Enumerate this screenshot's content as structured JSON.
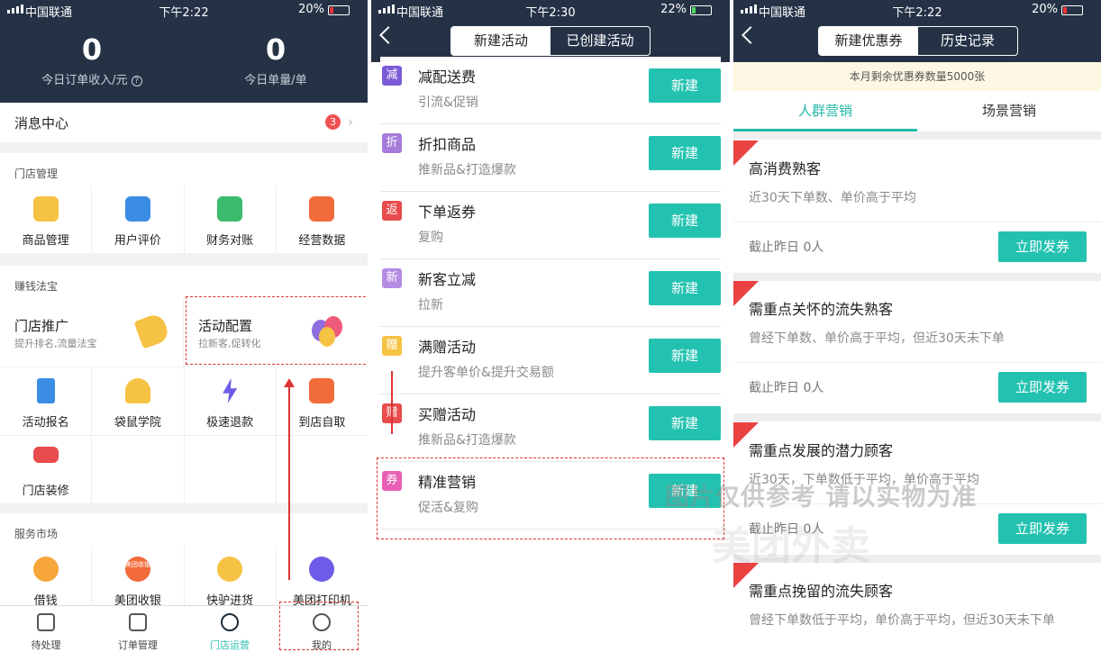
{
  "status": {
    "carrier": "中国联通",
    "time1": "下午2:22",
    "battery1": "20%",
    "time2": "下午2:30",
    "battery2": "22%",
    "time3": "下午2:22",
    "battery3": "20%"
  },
  "p1": {
    "stats": [
      {
        "value": "0",
        "label": "今日订单收入/元"
      },
      {
        "value": "0",
        "label": "今日单量/单"
      }
    ],
    "message": {
      "label": "消息中心",
      "count": "3"
    },
    "store_section": "门店管理",
    "store_items": [
      {
        "label": "商品管理",
        "color": "#f6c243"
      },
      {
        "label": "用户评价",
        "color": "#3b8de4"
      },
      {
        "label": "财务对账",
        "color": "#3dbb6c"
      },
      {
        "label": "经营数据",
        "color": "#f26b3a"
      }
    ],
    "money_section": "赚钱法宝",
    "promo": [
      {
        "title": "门店推广",
        "sub": "提升排名,流量法宝"
      },
      {
        "title": "活动配置",
        "sub": "拉新客,促转化"
      }
    ],
    "money_items": [
      {
        "label": "活动报名",
        "color": "#3b8de4"
      },
      {
        "label": "袋鼠学院",
        "color": "#f6c243"
      },
      {
        "label": "极速退款",
        "color": "#6c5ce7"
      },
      {
        "label": "到店自取",
        "color": "#f26b3a"
      },
      {
        "label": "门店装修",
        "color": "#e84c4c"
      }
    ],
    "service_section": "服务市场",
    "service_items": [
      {
        "label": "借钱",
        "color": "#f6a63a"
      },
      {
        "label": "美团收银",
        "color": "#f26b3a",
        "inner": "美团收银"
      },
      {
        "label": "快驴进货",
        "color": "#f6c243"
      },
      {
        "label": "美团打印机",
        "color": "#6c5ce7"
      }
    ],
    "tabs": [
      {
        "label": "待处理",
        "icon": "clipboard-icon"
      },
      {
        "label": "订单管理",
        "icon": "order-icon"
      },
      {
        "label": "门店运营",
        "icon": "network-icon"
      },
      {
        "label": "我的",
        "icon": "user-icon"
      }
    ]
  },
  "p2": {
    "tabs": [
      "新建活动",
      "已创建活动"
    ],
    "activities": [
      {
        "tag": "减",
        "tag_color": "#7b5bd6",
        "title": "减配送费",
        "sub": "引流&促销",
        "btn": "新建"
      },
      {
        "tag": "折",
        "tag_color": "#a67bd9",
        "title": "折扣商品",
        "sub": "推新品&打造爆款",
        "btn": "新建"
      },
      {
        "tag": "返",
        "tag_color": "#e84c4c",
        "title": "下单返券",
        "sub": "复购",
        "btn": "新建"
      },
      {
        "tag": "新",
        "tag_color": "#b58be3",
        "title": "新客立减",
        "sub": "拉新",
        "btn": "新建"
      },
      {
        "tag": "赠",
        "tag_color": "#f6c243",
        "title": "满赠活动",
        "sub": "提升客单价&提升交易额",
        "btn": "新建"
      },
      {
        "tag": "赠",
        "tag_color": "#e84c4c",
        "title": "买赠活动",
        "sub": "推新品&打造爆款",
        "btn": "新建"
      },
      {
        "tag": "券",
        "tag_color": "#e85fb3",
        "title": "精准营销",
        "sub": "促活&复购",
        "btn": "新建"
      }
    ]
  },
  "p3": {
    "tabs": [
      "新建优惠券",
      "历史记录"
    ],
    "notice": "本月剩余优惠券数量5000张",
    "subtabs": [
      "人群营销",
      "场景营销"
    ],
    "coupons": [
      {
        "title": "高消费熟客",
        "desc": "近30天下单数、单价高于平均",
        "count": "截止昨日 0人",
        "btn": "立即发券"
      },
      {
        "title": "需重点关怀的流失熟客",
        "desc": "曾经下单数、单价高于平均，但近30天未下单",
        "count": "截止昨日 0人",
        "btn": "立即发券"
      },
      {
        "title": "需重点发展的潜力顾客",
        "desc": "近30天，下单数低于平均，单价高于平均",
        "count": "截止昨日 0人",
        "btn": "立即发券"
      },
      {
        "title": "需重点挽留的流失顾客",
        "desc": "曾经下单数低于平均，单价高于平均，但近30天未下单",
        "count": "",
        "btn": ""
      }
    ],
    "watermark": "图片仅供参考 请以实物为准",
    "watermark2": "美团外卖"
  }
}
